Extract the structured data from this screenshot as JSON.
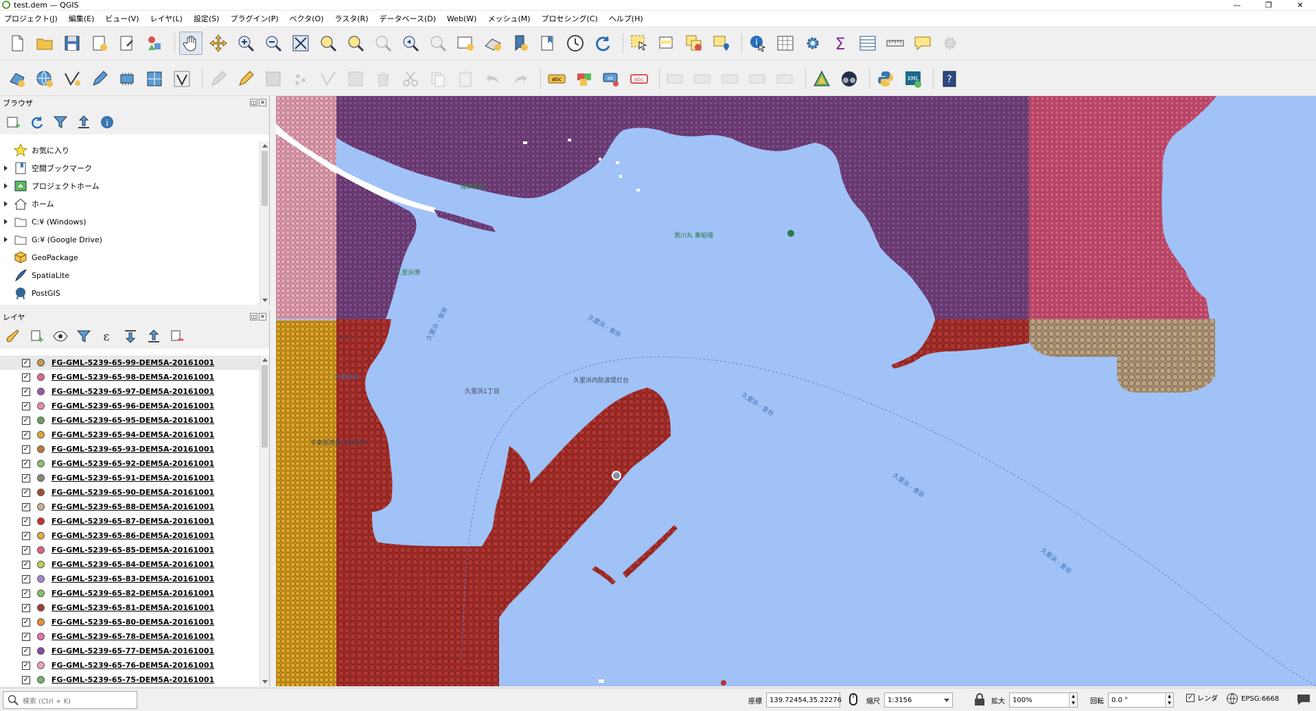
{
  "window": {
    "title": "test.dem — QGIS",
    "controls": [
      "—",
      "❐",
      "✕"
    ]
  },
  "menubar": [
    "プロジェクト(J)",
    "編集(E)",
    "ビュー(V)",
    "レイヤ(L)",
    "設定(S)",
    "プラグイン(P)",
    "ベクタ(O)",
    "ラスタ(R)",
    "データベース(D)",
    "Web(W)",
    "メッシュ(M)",
    "プロセシング(C)",
    "ヘルプ(H)"
  ],
  "browser": {
    "title": "ブラウザ",
    "items": [
      {
        "label": "お気に入り",
        "icon": "star-icon",
        "expandable": false
      },
      {
        "label": "空間ブックマーク",
        "icon": "bookmark-icon",
        "expandable": true
      },
      {
        "label": "プロジェクトホーム",
        "icon": "project-home-icon",
        "expandable": true
      },
      {
        "label": "ホーム",
        "icon": "home-icon",
        "expandable": true
      },
      {
        "label": "C:¥ (Windows)",
        "icon": "folder-icon",
        "expandable": true
      },
      {
        "label": "G:¥ (Google Drive)",
        "icon": "folder-icon",
        "expandable": true
      },
      {
        "label": "GeoPackage",
        "icon": "geopackage-icon",
        "expandable": false
      },
      {
        "label": "SpatiaLite",
        "icon": "spatialite-icon",
        "expandable": false
      },
      {
        "label": "PostGIS",
        "icon": "postgis-icon",
        "expandable": false
      }
    ]
  },
  "layers": {
    "title": "レイヤ",
    "items": [
      {
        "name": "FG-GML-5239-65-99-DEM5A-20161001",
        "color": "#c69a4a",
        "checked": true,
        "selected": true
      },
      {
        "name": "FG-GML-5239-65-98-DEM5A-20161001",
        "color": "#e06890",
        "checked": true
      },
      {
        "name": "FG-GML-5239-65-97-DEM5A-20161001",
        "color": "#9b59b6",
        "checked": true
      },
      {
        "name": "FG-GML-5239-65-96-DEM5A-20161001",
        "color": "#e58ab0",
        "checked": true
      },
      {
        "name": "FG-GML-5239-65-95-DEM5A-20161001",
        "color": "#6aa25e",
        "checked": true
      },
      {
        "name": "FG-GML-5239-65-94-DEM5A-20161001",
        "color": "#e0a838",
        "checked": true
      },
      {
        "name": "FG-GML-5239-65-93-DEM5A-20161001",
        "color": "#c07838",
        "checked": true
      },
      {
        "name": "FG-GML-5239-65-92-DEM5A-20161001",
        "color": "#8cc070",
        "checked": true
      },
      {
        "name": "FG-GML-5239-65-91-DEM5A-20161001",
        "color": "#888878",
        "checked": true
      },
      {
        "name": "FG-GML-5239-65-90-DEM5A-20161001",
        "color": "#a05030",
        "checked": true
      },
      {
        "name": "FG-GML-5239-65-88-DEM5A-20161001",
        "color": "#c8b090",
        "checked": true
      },
      {
        "name": "FG-GML-5239-65-87-DEM5A-20161001",
        "color": "#c83030",
        "checked": true
      },
      {
        "name": "FG-GML-5239-65-86-DEM5A-20161001",
        "color": "#e8a840",
        "checked": true
      },
      {
        "name": "FG-GML-5239-65-85-DEM5A-20161001",
        "color": "#e86080",
        "checked": true
      },
      {
        "name": "FG-GML-5239-65-84-DEM5A-20161001",
        "color": "#b8d060",
        "checked": true
      },
      {
        "name": "FG-GML-5239-65-83-DEM5A-20161001",
        "color": "#a888d8",
        "checked": true
      },
      {
        "name": "FG-GML-5239-65-82-DEM5A-20161001",
        "color": "#88c068",
        "checked": true
      },
      {
        "name": "FG-GML-5239-65-81-DEM5A-20161001",
        "color": "#a83838",
        "checked": true
      },
      {
        "name": "FG-GML-5239-65-80-DEM5A-20161001",
        "color": "#e89030",
        "checked": true
      },
      {
        "name": "FG-GML-5239-65-78-DEM5A-20161001",
        "color": "#e870a0",
        "checked": true
      },
      {
        "name": "FG-GML-5239-65-77-DEM5A-20161001",
        "color": "#8a4aa0",
        "checked": true
      },
      {
        "name": "FG-GML-5239-65-76-DEM5A-20161001",
        "color": "#f0a0b8",
        "checked": true
      },
      {
        "name": "FG-GML-5239-65-75-DEM5A-20161001",
        "color": "#78b070",
        "checked": true
      }
    ]
  },
  "map_labels": {
    "l1": "海岸緑地",
    "l2": "黒川丸 乗船場",
    "l3": "久里浜港",
    "l4": "久里浜店",
    "l5": "久里浜1丁目",
    "l6": "久里浜内防波堤灯台",
    "l7": "久里浜 - 金谷",
    "l8": "久里浜 - 金谷",
    "l9": "久里浜 - 金谷",
    "l10": "久里浜 - 金谷",
    "l11": "久里浜 - 金谷",
    "l12": "平東部漁業 協同組合",
    "l13": "タウン"
  },
  "status": {
    "search_placeholder": "検索 (Ctrl + K)",
    "coord_label": "座標",
    "coord_value": "139.72454,35.22276",
    "scale_label": "縮尺",
    "scale_value": "1:3156",
    "magnify_label": "拡大",
    "magnify_value": "100%",
    "rotation_label": "回転",
    "rotation_value": "0.0 °",
    "render_label": "レンダ",
    "render_checked": true,
    "crs": "EPSG:6668"
  }
}
